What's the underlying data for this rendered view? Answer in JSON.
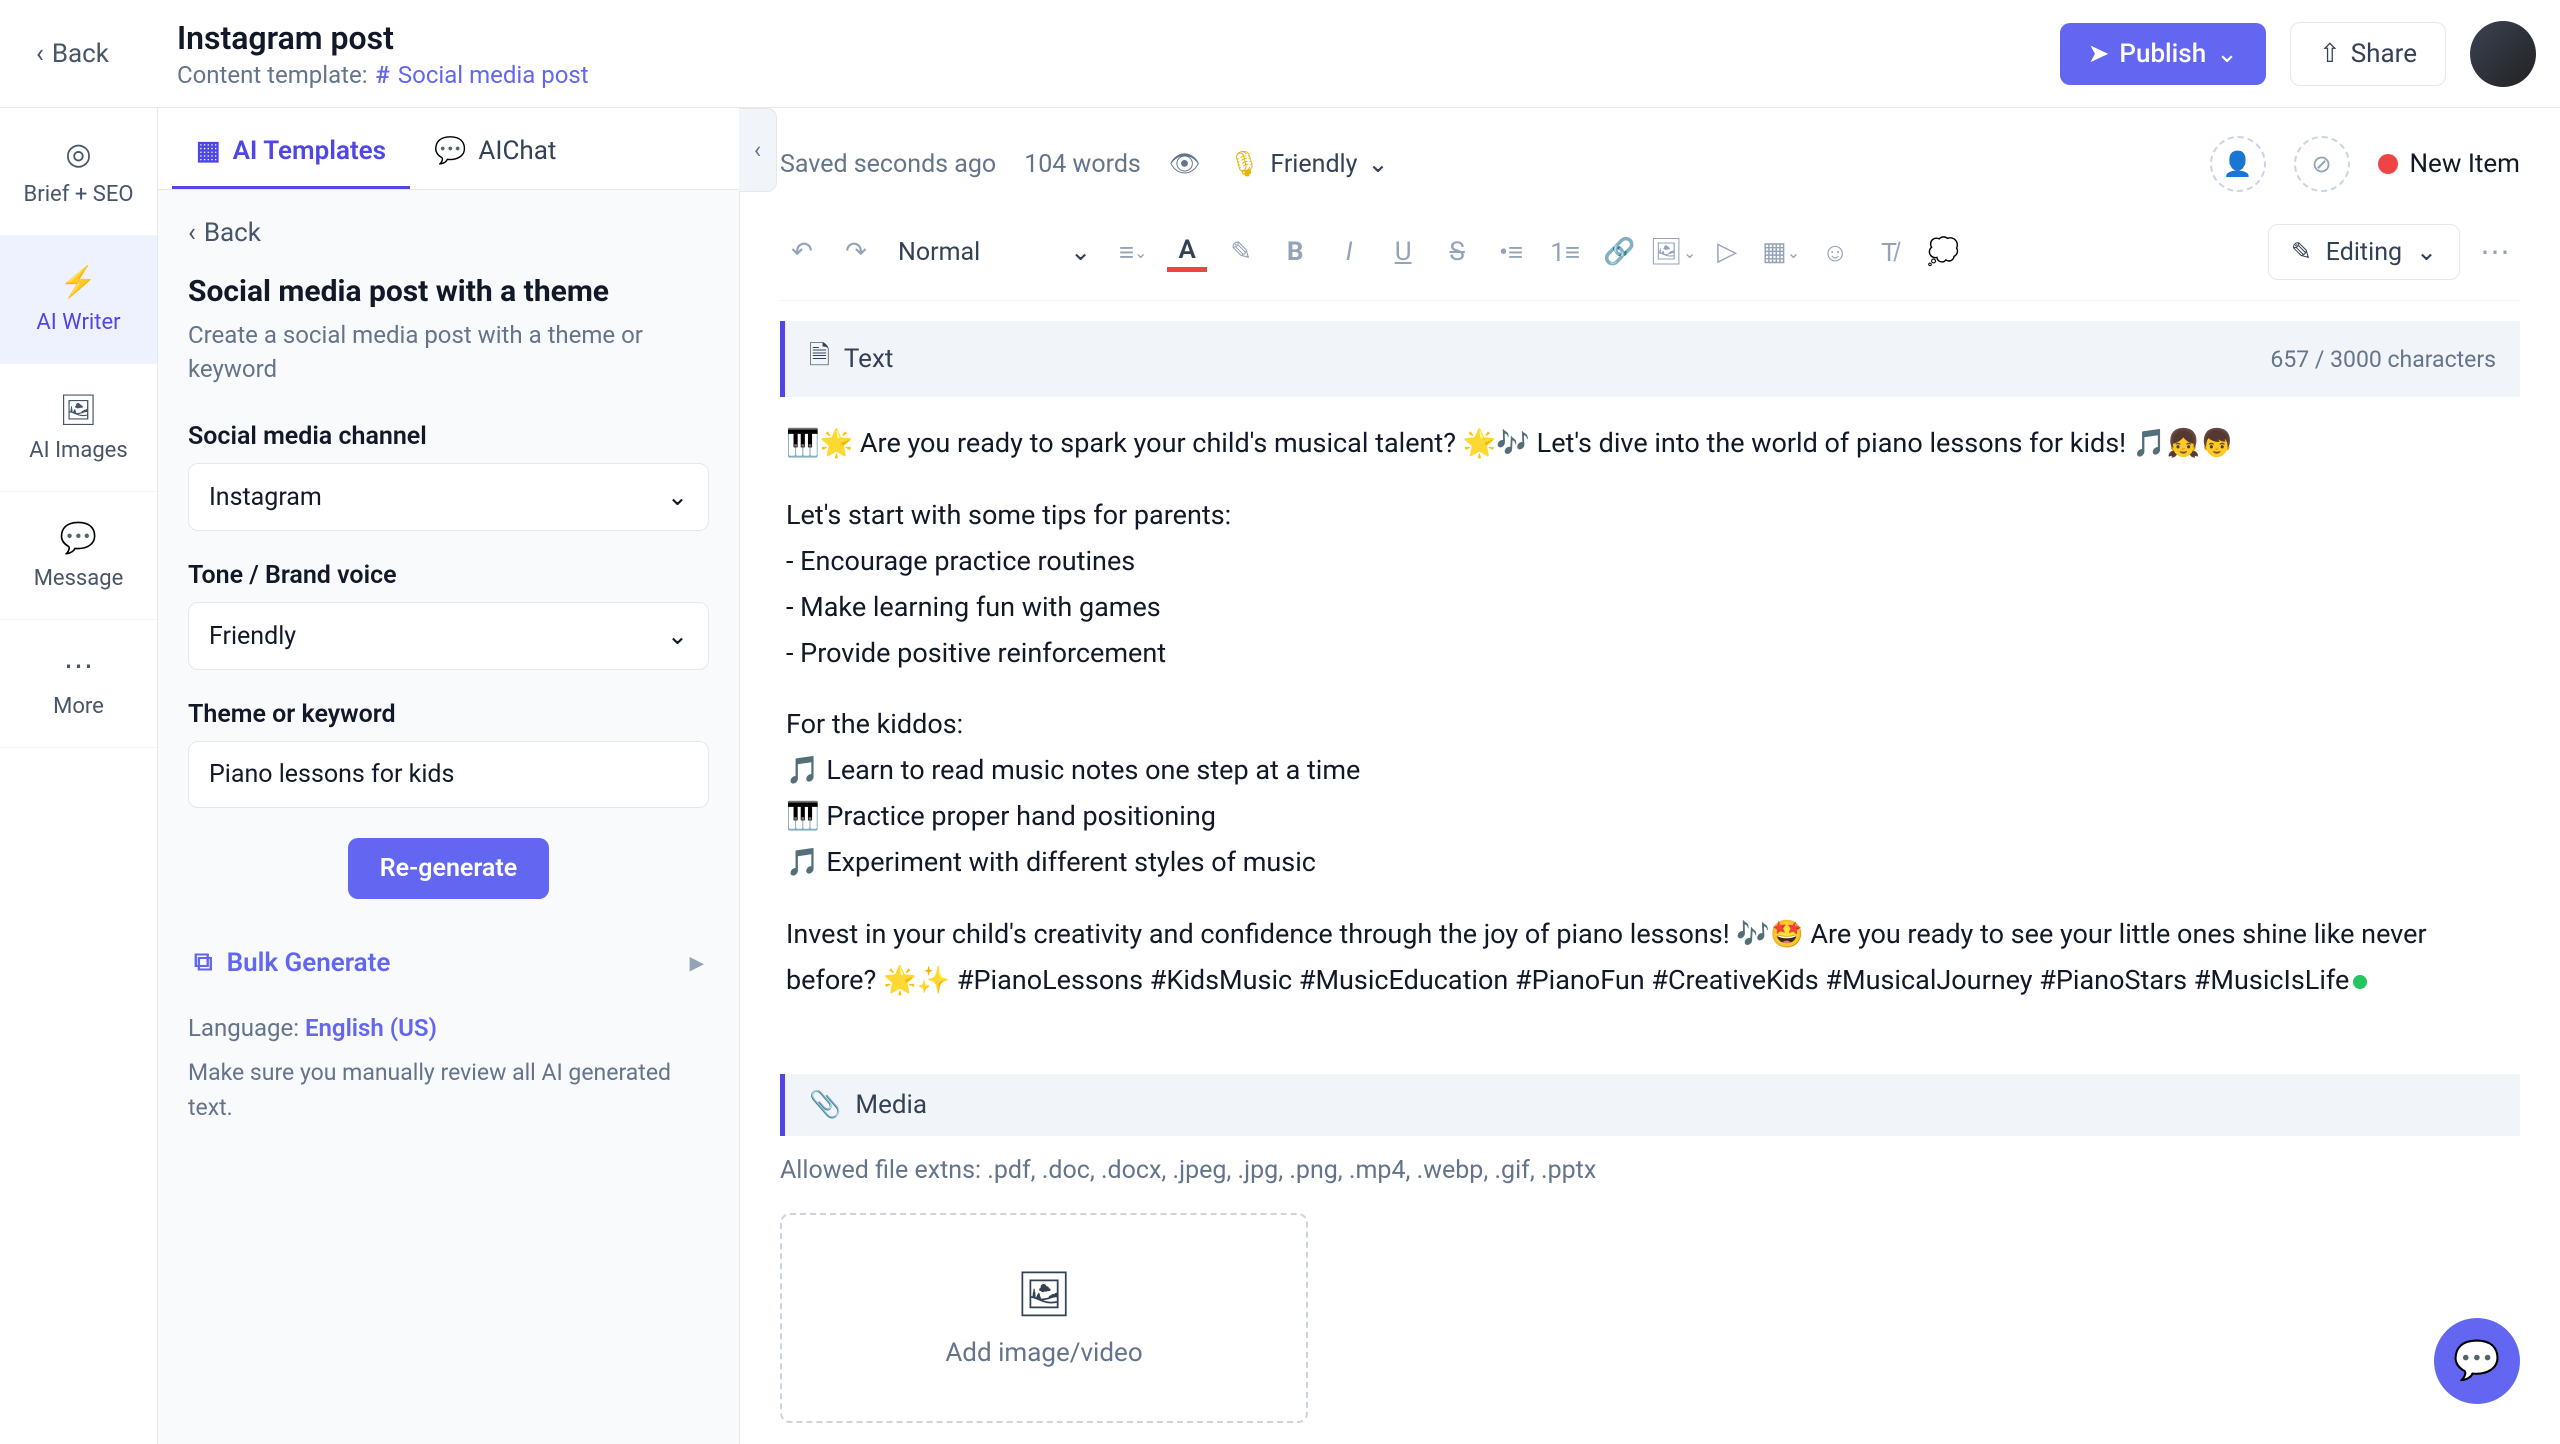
{
  "topbar": {
    "back": "Back",
    "title": "Instagram post",
    "template_prefix": "Content template:",
    "template_link": "Social media post",
    "publish": "Publish",
    "share": "Share"
  },
  "rail": {
    "brief": "Brief + SEO",
    "writer": "AI Writer",
    "images": "AI Images",
    "message": "Message",
    "more": "More"
  },
  "sidepanel": {
    "tabs": {
      "templates": "AI Templates",
      "chat": "AIChat"
    },
    "back": "Back",
    "heading": "Social media post with a theme",
    "subheading": "Create a social media post with a theme or keyword",
    "channel_label": "Social media channel",
    "channel_value": "Instagram",
    "tone_label": "Tone / Brand voice",
    "tone_value": "Friendly",
    "theme_label": "Theme or keyword",
    "theme_value": "Piano lessons for kids",
    "regenerate": "Re-generate",
    "bulk": "Bulk Generate",
    "language_label": "Language: ",
    "language_value": "English (US)",
    "disclaimer": "Make sure you manually review all AI generated text."
  },
  "editor": {
    "saved": "Saved seconds ago",
    "words": "104 words",
    "tone": "Friendly",
    "status": "New Item",
    "style_select": "Normal",
    "editing": "Editing",
    "text_block_label": "Text",
    "char_count": "657 / 3000 characters",
    "para1": "🎹🌟 Are you ready to spark your child's musical talent? 🌟🎶 Let's dive into the world of piano lessons for kids! 🎵👧👦",
    "para2": "Let's start with some tips for parents:",
    "b1": "- Encourage practice routines",
    "b2": "- Make learning fun with games",
    "b3": "- Provide positive reinforcement",
    "para3": "For the kiddos:",
    "k1": "🎵 Learn to read music notes one step at a time",
    "k2": "🎹 Practice proper hand positioning",
    "k3": "🎵 Experiment with different styles of music",
    "para4a": "Invest in your child's creativity and confidence through the joy of piano lessons! 🎶🤩 Are you ready to see your little ones shine like never before? 🌟✨ #PianoLessons #KidsMusic #MusicEducation #PianoFun #CreativeKids #MusicalJourney #PianoStars #MusicIsLife",
    "media_block_label": "Media",
    "allowed": "Allowed file extns: .pdf, .doc, .docx, .jpeg, .jpg, .png, .mp4, .webp, .gif, .pptx",
    "add_media": "Add image/video"
  }
}
